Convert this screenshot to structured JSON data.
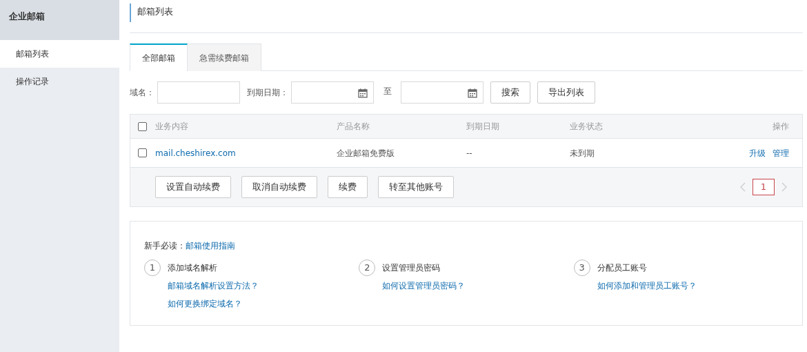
{
  "sidebar": {
    "title": "企业邮箱",
    "items": [
      {
        "label": "邮箱列表",
        "selected": true
      },
      {
        "label": "操作记录",
        "selected": false
      }
    ]
  },
  "page_title": "邮箱列表",
  "tabs": [
    {
      "label": "全部邮箱",
      "selected": true
    },
    {
      "label": "急需续费邮箱",
      "selected": false
    }
  ],
  "filters": {
    "domain_label": "域名：",
    "date_label": "到期日期：",
    "range_separator": "至",
    "buttons": [
      "搜索",
      "导出列表"
    ]
  },
  "table": {
    "select_all": {
      "checked": false
    },
    "columns": [
      "业务内容",
      "产品名称",
      "到期日期",
      "业务状态",
      "操作"
    ],
    "rows": [
      {
        "checked": false,
        "cells": [
          "mail.cheshirex.com",
          "企业邮箱免费版",
          "--",
          "未到期"
        ],
        "actions": [
          "升级",
          "管理"
        ]
      }
    ],
    "bulk_buttons": [
      "设置自动续费",
      "取消自动续费",
      "续费",
      "转至其他账号"
    ],
    "pagination": {
      "pages": [
        {
          "label": "1",
          "selected": true
        }
      ]
    }
  },
  "guide": {
    "intro": "新手必读：",
    "intro_link": "邮箱使用指南",
    "steps": [
      {
        "number": "1",
        "title": "添加域名解析",
        "links": [
          "邮箱域名解析设置方法？",
          "如何更换绑定域名？"
        ]
      },
      {
        "number": "2",
        "title": "设置管理员密码",
        "links": [
          "如何设置管理员密码？"
        ]
      },
      {
        "number": "3",
        "title": "分配员工账号",
        "links": [
          "如何添加和管理员工账号？"
        ]
      }
    ]
  }
}
